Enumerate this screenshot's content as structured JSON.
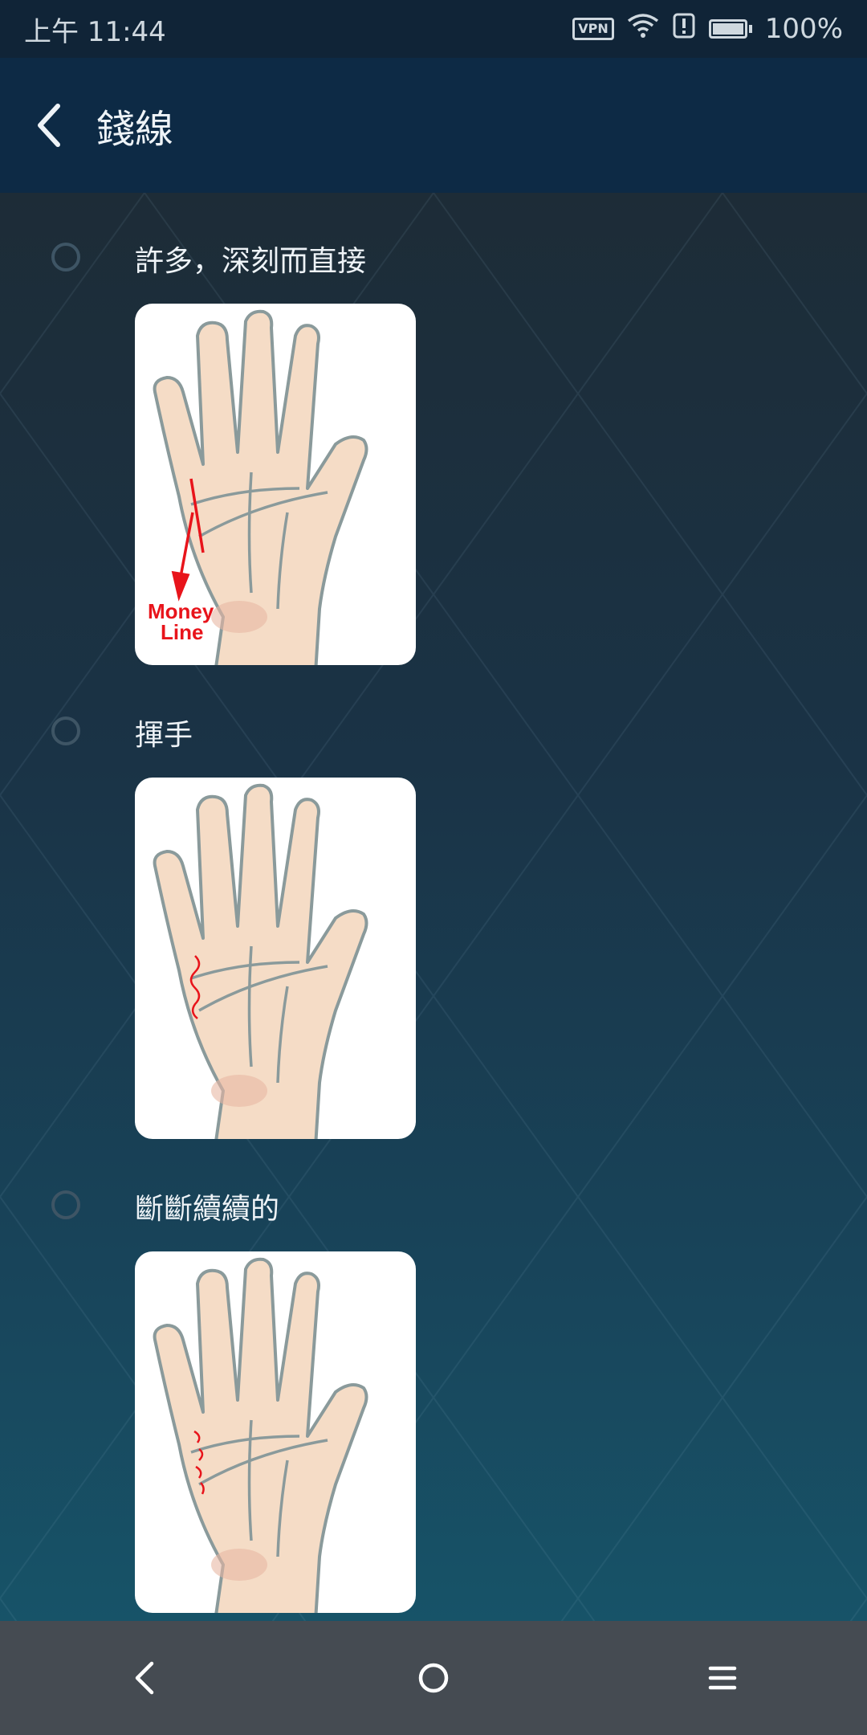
{
  "status_bar": {
    "time": "上午 11:44",
    "vpn_label": "VPN",
    "battery_percent_text": "100%",
    "battery_level": 1.0,
    "icons": [
      "vpn-icon",
      "wifi-icon",
      "alert-icon",
      "battery-icon"
    ]
  },
  "app_bar": {
    "title": "錢線",
    "back_icon": "chevron-left-icon"
  },
  "options": [
    {
      "label": "許多，深刻而直接",
      "selected": false,
      "image": "palm-money-line-deep-straight",
      "annotation_text": [
        "Money",
        "Line"
      ]
    },
    {
      "label": "揮手",
      "selected": false,
      "image": "palm-money-line-wavy"
    },
    {
      "label": "斷斷續續的",
      "selected": false,
      "image": "palm-money-line-broken"
    }
  ],
  "nav_bar": {
    "back_icon": "triangle-back-icon",
    "home_icon": "circle-home-icon",
    "menu_icon": "hamburger-menu-icon"
  },
  "colors": {
    "status_bar_bg": "#102437",
    "app_bar_bg": "#0d2a45",
    "content_bg_top": "#1d2c37",
    "content_bg_bottom": "#175368",
    "nav_bar_bg": "#454b52",
    "money_line_red": "#e8141b"
  }
}
